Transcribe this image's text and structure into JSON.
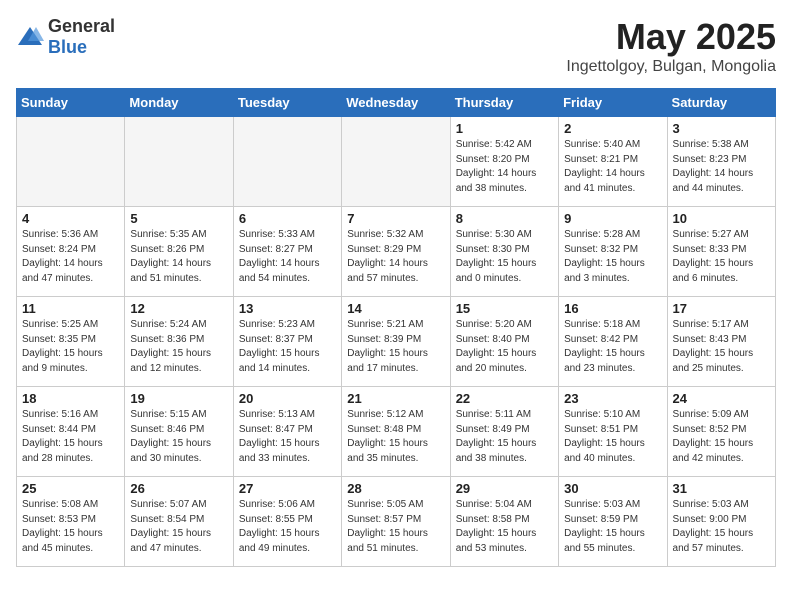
{
  "logo": {
    "general": "General",
    "blue": "Blue"
  },
  "header": {
    "month": "May 2025",
    "location": "Ingettolgoy, Bulgan, Mongolia"
  },
  "weekdays": [
    "Sunday",
    "Monday",
    "Tuesday",
    "Wednesday",
    "Thursday",
    "Friday",
    "Saturday"
  ],
  "weeks": [
    [
      {
        "day": "",
        "info": ""
      },
      {
        "day": "",
        "info": ""
      },
      {
        "day": "",
        "info": ""
      },
      {
        "day": "",
        "info": ""
      },
      {
        "day": "1",
        "info": "Sunrise: 5:42 AM\nSunset: 8:20 PM\nDaylight: 14 hours\nand 38 minutes."
      },
      {
        "day": "2",
        "info": "Sunrise: 5:40 AM\nSunset: 8:21 PM\nDaylight: 14 hours\nand 41 minutes."
      },
      {
        "day": "3",
        "info": "Sunrise: 5:38 AM\nSunset: 8:23 PM\nDaylight: 14 hours\nand 44 minutes."
      }
    ],
    [
      {
        "day": "4",
        "info": "Sunrise: 5:36 AM\nSunset: 8:24 PM\nDaylight: 14 hours\nand 47 minutes."
      },
      {
        "day": "5",
        "info": "Sunrise: 5:35 AM\nSunset: 8:26 PM\nDaylight: 14 hours\nand 51 minutes."
      },
      {
        "day": "6",
        "info": "Sunrise: 5:33 AM\nSunset: 8:27 PM\nDaylight: 14 hours\nand 54 minutes."
      },
      {
        "day": "7",
        "info": "Sunrise: 5:32 AM\nSunset: 8:29 PM\nDaylight: 14 hours\nand 57 minutes."
      },
      {
        "day": "8",
        "info": "Sunrise: 5:30 AM\nSunset: 8:30 PM\nDaylight: 15 hours\nand 0 minutes."
      },
      {
        "day": "9",
        "info": "Sunrise: 5:28 AM\nSunset: 8:32 PM\nDaylight: 15 hours\nand 3 minutes."
      },
      {
        "day": "10",
        "info": "Sunrise: 5:27 AM\nSunset: 8:33 PM\nDaylight: 15 hours\nand 6 minutes."
      }
    ],
    [
      {
        "day": "11",
        "info": "Sunrise: 5:25 AM\nSunset: 8:35 PM\nDaylight: 15 hours\nand 9 minutes."
      },
      {
        "day": "12",
        "info": "Sunrise: 5:24 AM\nSunset: 8:36 PM\nDaylight: 15 hours\nand 12 minutes."
      },
      {
        "day": "13",
        "info": "Sunrise: 5:23 AM\nSunset: 8:37 PM\nDaylight: 15 hours\nand 14 minutes."
      },
      {
        "day": "14",
        "info": "Sunrise: 5:21 AM\nSunset: 8:39 PM\nDaylight: 15 hours\nand 17 minutes."
      },
      {
        "day": "15",
        "info": "Sunrise: 5:20 AM\nSunset: 8:40 PM\nDaylight: 15 hours\nand 20 minutes."
      },
      {
        "day": "16",
        "info": "Sunrise: 5:18 AM\nSunset: 8:42 PM\nDaylight: 15 hours\nand 23 minutes."
      },
      {
        "day": "17",
        "info": "Sunrise: 5:17 AM\nSunset: 8:43 PM\nDaylight: 15 hours\nand 25 minutes."
      }
    ],
    [
      {
        "day": "18",
        "info": "Sunrise: 5:16 AM\nSunset: 8:44 PM\nDaylight: 15 hours\nand 28 minutes."
      },
      {
        "day": "19",
        "info": "Sunrise: 5:15 AM\nSunset: 8:46 PM\nDaylight: 15 hours\nand 30 minutes."
      },
      {
        "day": "20",
        "info": "Sunrise: 5:13 AM\nSunset: 8:47 PM\nDaylight: 15 hours\nand 33 minutes."
      },
      {
        "day": "21",
        "info": "Sunrise: 5:12 AM\nSunset: 8:48 PM\nDaylight: 15 hours\nand 35 minutes."
      },
      {
        "day": "22",
        "info": "Sunrise: 5:11 AM\nSunset: 8:49 PM\nDaylight: 15 hours\nand 38 minutes."
      },
      {
        "day": "23",
        "info": "Sunrise: 5:10 AM\nSunset: 8:51 PM\nDaylight: 15 hours\nand 40 minutes."
      },
      {
        "day": "24",
        "info": "Sunrise: 5:09 AM\nSunset: 8:52 PM\nDaylight: 15 hours\nand 42 minutes."
      }
    ],
    [
      {
        "day": "25",
        "info": "Sunrise: 5:08 AM\nSunset: 8:53 PM\nDaylight: 15 hours\nand 45 minutes."
      },
      {
        "day": "26",
        "info": "Sunrise: 5:07 AM\nSunset: 8:54 PM\nDaylight: 15 hours\nand 47 minutes."
      },
      {
        "day": "27",
        "info": "Sunrise: 5:06 AM\nSunset: 8:55 PM\nDaylight: 15 hours\nand 49 minutes."
      },
      {
        "day": "28",
        "info": "Sunrise: 5:05 AM\nSunset: 8:57 PM\nDaylight: 15 hours\nand 51 minutes."
      },
      {
        "day": "29",
        "info": "Sunrise: 5:04 AM\nSunset: 8:58 PM\nDaylight: 15 hours\nand 53 minutes."
      },
      {
        "day": "30",
        "info": "Sunrise: 5:03 AM\nSunset: 8:59 PM\nDaylight: 15 hours\nand 55 minutes."
      },
      {
        "day": "31",
        "info": "Sunrise: 5:03 AM\nSunset: 9:00 PM\nDaylight: 15 hours\nand 57 minutes."
      }
    ]
  ]
}
